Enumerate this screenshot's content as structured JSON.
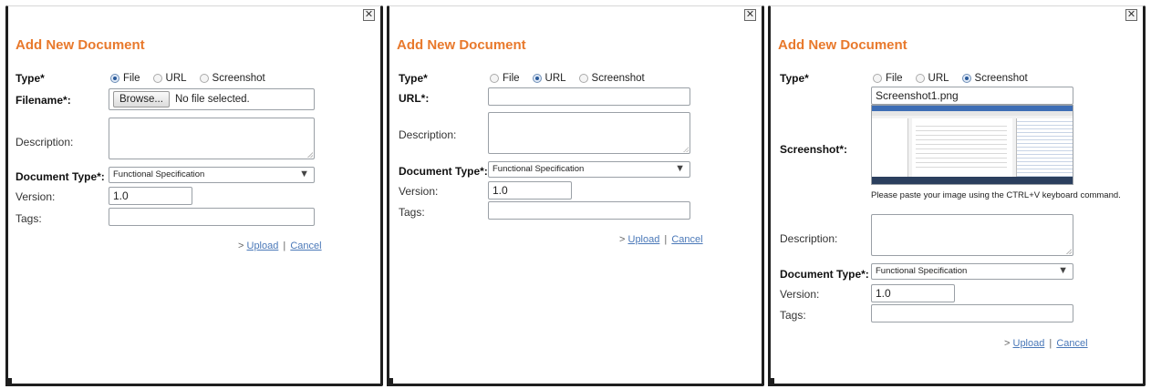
{
  "dialogs": [
    {
      "title": "Add New Document",
      "close": "✕",
      "type_label": "Type*",
      "type_options": [
        "File",
        "URL",
        "Screenshot"
      ],
      "selected_type": "File",
      "filename_label": "Filename*:",
      "browse_label": "Browse...",
      "file_status": "No file selected.",
      "description_label": "Description:",
      "document_type_label": "Document Type*:",
      "document_type_value": "Functional Specification",
      "version_label": "Version:",
      "version_value": "1.0",
      "tags_label": "Tags:",
      "action_prefix": ">",
      "upload_label": "Upload",
      "separator": "|",
      "cancel_label": "Cancel"
    },
    {
      "title": "Add New Document",
      "close": "✕",
      "type_label": "Type*",
      "type_options": [
        "File",
        "URL",
        "Screenshot"
      ],
      "selected_type": "URL",
      "url_label": "URL*:",
      "url_value": "",
      "description_label": "Description:",
      "document_type_label": "Document Type*:",
      "document_type_value": "Functional Specification",
      "version_label": "Version:",
      "version_value": "1.0",
      "tags_label": "Tags:",
      "action_prefix": ">",
      "upload_label": "Upload",
      "separator": "|",
      "cancel_label": "Cancel"
    },
    {
      "title": "Add New Document",
      "close": "✕",
      "type_label": "Type*",
      "type_options": [
        "File",
        "URL",
        "Screenshot"
      ],
      "selected_type": "Screenshot",
      "screenshot_name": "Screenshot1.png",
      "screenshot_label": "Screenshot*:",
      "screenshot_hint": "Please paste your image using the CTRL+V keyboard command.",
      "description_label": "Description:",
      "document_type_label": "Document Type*:",
      "document_type_value": "Functional Specification",
      "version_label": "Version:",
      "version_value": "1.0",
      "tags_label": "Tags:",
      "action_prefix": ">",
      "upload_label": "Upload",
      "separator": "|",
      "cancel_label": "Cancel"
    }
  ],
  "icons": {
    "close": "close-icon",
    "dropdown": "chevron-down-icon",
    "select_arrow_glyph": "▼"
  },
  "colors": {
    "title": "#e8792c",
    "link": "#4a78b8",
    "frame": "#1e1e1e"
  }
}
